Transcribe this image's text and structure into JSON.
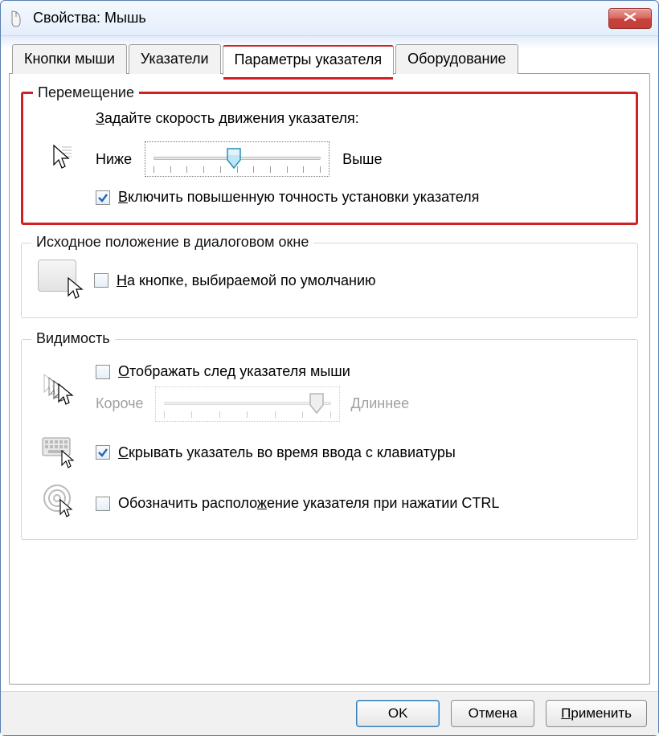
{
  "window": {
    "title": "Свойства: Мышь",
    "close_label": "Закрыть"
  },
  "tabs": [
    {
      "label": "Кнопки мыши",
      "active": false
    },
    {
      "label": "Указатели",
      "active": false
    },
    {
      "label": "Параметры указателя",
      "active": true
    },
    {
      "label": "Оборудование",
      "active": false
    }
  ],
  "group_motion": {
    "legend": "Перемещение",
    "instruction": "Задайте скорость движения указателя:",
    "slower": "Ниже",
    "faster": "Выше",
    "slider_pos_percent": 48,
    "precision": {
      "checked": true,
      "label": "Включить повышенную точность установки указателя"
    }
  },
  "group_snap": {
    "legend": "Исходное положение в диалоговом окне",
    "snap": {
      "checked": false,
      "label": "На кнопке, выбираемой по умолчанию"
    }
  },
  "group_vis": {
    "legend": "Видимость",
    "trail": {
      "checked": false,
      "label": "Отображать след указателя мыши"
    },
    "trail_shorter": "Короче",
    "trail_longer": "Длиннее",
    "trail_pos_percent": 88,
    "hide_typing": {
      "checked": true,
      "label": "Скрывать указатель во время ввода с клавиатуры"
    },
    "ctrl_locate": {
      "checked": false,
      "label": "Обозначить расположение указателя при нажатии CTRL"
    }
  },
  "buttons": {
    "ok": "OK",
    "cancel": "Отмена",
    "apply": "Применить"
  },
  "colors": {
    "highlight": "#d02020",
    "accent": "#3c7fb1"
  }
}
